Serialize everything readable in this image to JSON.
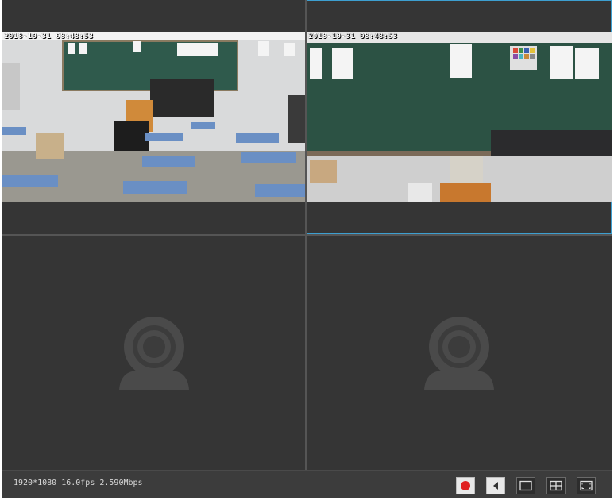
{
  "cameras": [
    {
      "osd_text": "2018-10-31 08:48:53"
    },
    {
      "osd_text": "2018-10-31 08:48:53"
    }
  ],
  "status": {
    "stream_info": "1920*1080 16.0fps 2.590Mbps"
  },
  "toolbar": {
    "buttons": [
      {
        "icon": "record-icon",
        "color": "#e02020"
      },
      {
        "icon": "audio-icon"
      },
      {
        "icon": "single-view-icon"
      },
      {
        "icon": "quad-view-icon"
      },
      {
        "icon": "fullscreen-icon"
      }
    ]
  },
  "colors": {
    "selected_border": "#3d9fd0",
    "background": "#353535"
  }
}
